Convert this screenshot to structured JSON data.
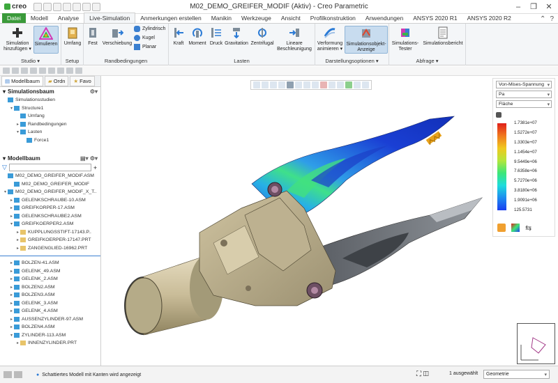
{
  "titlebar": {
    "logo": "creo",
    "window_title": "M02_DEMO_GREIFER_MODIF (Aktiv) - Creo Parametric",
    "minimize": "–",
    "restore": "❐",
    "close": "✕"
  },
  "tabs": [
    "Datei",
    "Modell",
    "Analyse",
    "Live-Simulation",
    "Anmerkungen erstellen",
    "Manikin",
    "Werkzeuge",
    "Ansicht",
    "Profilkonstruktion",
    "Anwendungen",
    "ANSYS 2020 R1",
    "ANSYS 2020 R2"
  ],
  "active_tab": "Live-Simulation",
  "ribbon": {
    "studio": {
      "label": "Studio ▾",
      "add": "Simulation hinzufügen ▾",
      "simulate": "Simulieren"
    },
    "setup": {
      "label": "Setup",
      "extent": "Umfang"
    },
    "constraints": {
      "label": "Randbedingungen",
      "fixed": "Fest",
      "displacement": "Verschiebung",
      "cylindrical": "Zylindrisch",
      "ball": "Kugel",
      "planar": "Planar"
    },
    "loads": {
      "label": "Lasten",
      "force": "Kraft",
      "moment": "Moment",
      "pressure": "Druck",
      "gravity": "Gravitation",
      "centrifugal": "Zentrifugal",
      "linear_accel": "Lineare Beschleunigung"
    },
    "display": {
      "label": "Darstellungsoptionen ▾",
      "animate": "Verformung animieren ▾",
      "sim_display": "Simulationsobjekt-Anzeige"
    },
    "query": {
      "label": "Abfrage ▾",
      "tester": "Simulations-Tester",
      "report": "Simulationsbericht"
    }
  },
  "left_panel": {
    "tabs": [
      "Modellbaum",
      "Ordn",
      "Favo"
    ],
    "sim_tree_title": "Simulationsbaum",
    "sim_tree": [
      {
        "label": "Simulationsstudien",
        "level": 0,
        "exp": ""
      },
      {
        "label": "Structure1",
        "level": 1,
        "exp": "▾"
      },
      {
        "label": "Umfang",
        "level": 2,
        "exp": ""
      },
      {
        "label": "Randbedingungen",
        "level": 2,
        "exp": "▸"
      },
      {
        "label": "Lasten",
        "level": 2,
        "exp": "▾"
      },
      {
        "label": "Force1",
        "level": 3,
        "exp": ""
      }
    ],
    "model_tree_title": "Modellbaum",
    "filter_placeholder": "",
    "model_tree": [
      {
        "label": "M02_DEMO_GREIFER_MODIF.ASM",
        "level": 0,
        "exp": ""
      },
      {
        "label": "M02_DEMO_GREIFER_MODIF",
        "level": 1,
        "exp": ""
      },
      {
        "label": "M02_DEMO_GREIFER_MODIF_X_T..",
        "level": 0,
        "exp": "▾"
      },
      {
        "label": "GELENKSCHRAUBE-10.ASM",
        "level": 1,
        "exp": "▸"
      },
      {
        "label": "GREIFKORPER-17.ASM",
        "level": 1,
        "exp": "▸"
      },
      {
        "label": "GELENKSCHRAUBE2.ASM",
        "level": 1,
        "exp": "▸"
      },
      {
        "label": "GREIFKOERPER2.ASM",
        "level": 1,
        "exp": "▾"
      },
      {
        "label": "KUPPLUNGSSTIFT-17143.P..",
        "level": 2,
        "exp": "▸"
      },
      {
        "label": "GREIFKOERPER-17147.PRT",
        "level": 2,
        "exp": "▸"
      },
      {
        "label": "ZANGENGLIED-16962.PRT",
        "level": 2,
        "exp": "▸"
      },
      {
        "label": "",
        "level": 0,
        "exp": ""
      },
      {
        "label": "BOLZEN-41.ASM",
        "level": 1,
        "exp": "▸"
      },
      {
        "label": "GELENK_49.ASM",
        "level": 1,
        "exp": "▸"
      },
      {
        "label": "GELENK_2.ASM",
        "level": 1,
        "exp": "▸"
      },
      {
        "label": "BOLZEN2.ASM",
        "level": 1,
        "exp": "▸"
      },
      {
        "label": "BOLZEN3.ASM",
        "level": 1,
        "exp": "▸"
      },
      {
        "label": "GELENK_3.ASM",
        "level": 1,
        "exp": "▸"
      },
      {
        "label": "GELENK_4.ASM",
        "level": 1,
        "exp": "▸"
      },
      {
        "label": "AUSSENZYLINDER-97.ASM",
        "level": 1,
        "exp": "▸"
      },
      {
        "label": "BOLZEN4.ASM",
        "level": 1,
        "exp": "▸"
      },
      {
        "label": "ZYLINDER-113.ASM",
        "level": 1,
        "exp": "▾"
      },
      {
        "label": "INNENZYLINDER.PRT",
        "level": 2,
        "exp": "▸"
      }
    ]
  },
  "legend": {
    "result": "Von-Mises-Spannung",
    "unit": "Pa",
    "display": "Fläche",
    "values": [
      "1.7381e+07",
      "1.5272e+07",
      "1.3303e+07",
      "1.1454e+07",
      "9.5449e+06",
      "7.6358e+06",
      "5.7270e+06",
      "3.8180e+06",
      "1.9091e+06",
      "125.5731"
    ]
  },
  "status": {
    "message": "Schattiertes Modell mit Kanten wird angezeigt",
    "selected": "1 ausgewählt",
    "filter": "Geometrie"
  },
  "colors": {
    "file_tab": "#3a9a3a",
    "ribbon_bg": "#f4f6f8",
    "selection": "#c8dcef"
  }
}
